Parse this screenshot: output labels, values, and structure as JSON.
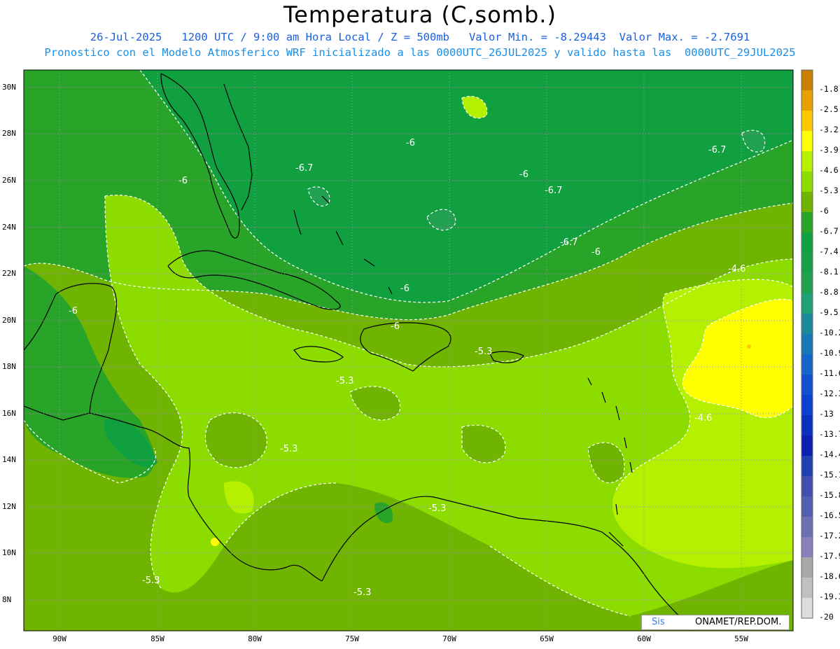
{
  "header": {
    "title": "Temperatura (C,somb.)",
    "line1": "26-Jul-2025   1200 UTC / 9:00 am Hora Local / Z = 500mb   Valor Min. = -8.29443  Valor Max. = -2.7691",
    "line2": "Pronostico con el Modelo Atmosferico WRF inicializado a las 0000UTC_26JUL2025 y valido hasta las  0000UTC_29JUL2025"
  },
  "axes": {
    "latitudes": [
      "30N",
      "28N",
      "26N",
      "24N",
      "22N",
      "20N",
      "18N",
      "16N",
      "14N",
      "12N",
      "10N",
      "8N"
    ],
    "longitudes": [
      "90W",
      "85W",
      "80W",
      "75W",
      "70W",
      "65W",
      "60W",
      "55W"
    ]
  },
  "colorbar": {
    "labels": [
      "-1.8",
      "-2.5",
      "-3.2",
      "-3.9",
      "-4.6",
      "-5.3",
      "-6",
      "-6.7",
      "-7.4",
      "-8.1",
      "-8.8",
      "-9.5",
      "-10.2",
      "-10.9",
      "-11.6",
      "-12.3",
      "-13",
      "-13.7",
      "-14.4",
      "-15.1",
      "-15.8",
      "-16.5",
      "-17.2",
      "-17.9",
      "-18.6",
      "-19.3",
      "-20"
    ],
    "colors": [
      "#c88000",
      "#e8a000",
      "#ffc800",
      "#ffff00",
      "#b4f000",
      "#8cdc00",
      "#6eb400",
      "#28a428",
      "#10a040",
      "#18a048",
      "#20a050",
      "#20a078",
      "#1a8a9a",
      "#1878b4",
      "#1466c8",
      "#1050d0",
      "#0c40d0",
      "#0a30c0",
      "#0a20b0",
      "#2040b0",
      "#4050b0",
      "#5060b0",
      "#6a70b0",
      "#8a80b8",
      "#a8a8a8",
      "#c0c0c0",
      "#dcdcdc"
    ]
  },
  "contour_labels": [
    "-6",
    "-6.7",
    "-6",
    "-6",
    "-6.7",
    "-6.7",
    "-6",
    "-6.7",
    "-6",
    "-4.6",
    "-6",
    "-6",
    "-5.3",
    "-5.3",
    "-4.6",
    "-5.3",
    "-5.3",
    "-5.3",
    "-5.3"
  ],
  "credit": {
    "left": "Sis",
    "right": "ONAMET/REP.DOM."
  }
}
